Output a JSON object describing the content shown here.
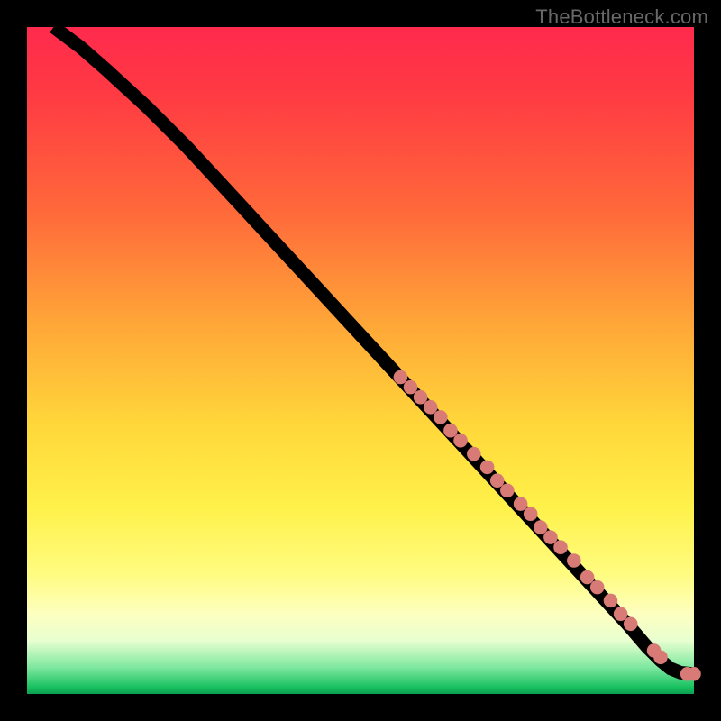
{
  "watermark": "TheBottleneck.com",
  "colors": {
    "marker": "#d87a76",
    "curve": "#000000"
  },
  "chart_data": {
    "type": "line",
    "title": "",
    "xlabel": "",
    "ylabel": "",
    "xlim": [
      0,
      100
    ],
    "ylim": [
      0,
      100
    ],
    "grid": false,
    "series": [
      {
        "name": "curve",
        "x": [
          4,
          8,
          12,
          18,
          24,
          30,
          36,
          42,
          48,
          54,
          60,
          66,
          72,
          78,
          84,
          90,
          93,
          95,
          96.5,
          98,
          100
        ],
        "y": [
          100,
          97,
          93.5,
          88,
          82,
          75.5,
          69,
          62.5,
          56,
          49.5,
          43,
          36.5,
          30,
          23.5,
          17,
          10.5,
          7,
          5,
          3.8,
          3.2,
          3
        ]
      }
    ],
    "markers": [
      {
        "x": 56,
        "y": 47.5
      },
      {
        "x": 57.5,
        "y": 46
      },
      {
        "x": 59,
        "y": 44.5
      },
      {
        "x": 60.5,
        "y": 43
      },
      {
        "x": 62,
        "y": 41.5
      },
      {
        "x": 63.5,
        "y": 39.5
      },
      {
        "x": 65,
        "y": 38
      },
      {
        "x": 67,
        "y": 36
      },
      {
        "x": 69,
        "y": 34
      },
      {
        "x": 70.5,
        "y": 32
      },
      {
        "x": 72,
        "y": 30.5
      },
      {
        "x": 74,
        "y": 28.5
      },
      {
        "x": 75.5,
        "y": 27
      },
      {
        "x": 77,
        "y": 25
      },
      {
        "x": 78.5,
        "y": 23.5
      },
      {
        "x": 80,
        "y": 22
      },
      {
        "x": 82,
        "y": 20
      },
      {
        "x": 84,
        "y": 17.5
      },
      {
        "x": 85.5,
        "y": 16
      },
      {
        "x": 87.5,
        "y": 14
      },
      {
        "x": 89,
        "y": 12
      },
      {
        "x": 90.5,
        "y": 10.5
      },
      {
        "x": 94,
        "y": 6.5
      },
      {
        "x": 95,
        "y": 5.5
      },
      {
        "x": 99,
        "y": 3
      },
      {
        "x": 100,
        "y": 3
      }
    ]
  }
}
